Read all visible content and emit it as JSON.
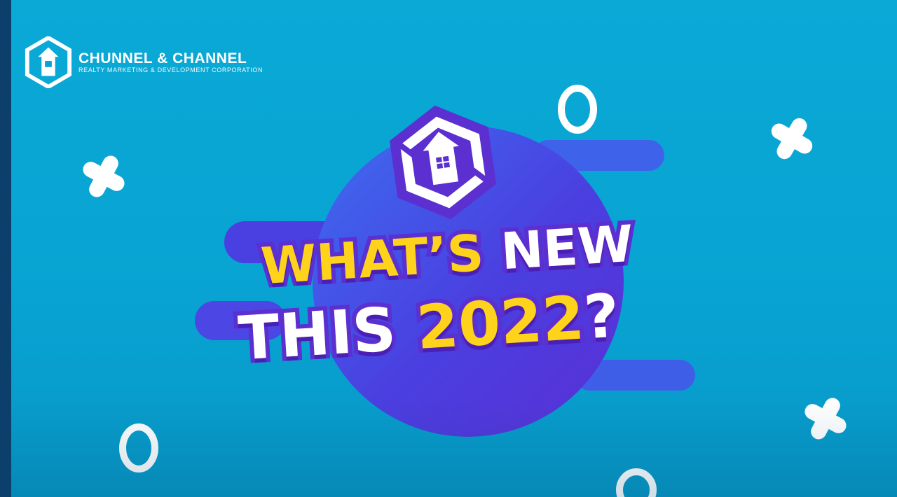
{
  "brand": {
    "name": "CHUNNEL & CHANNEL",
    "tagline": "REALTY MARKETING & DEVELOPMENT CORPORATION"
  },
  "headline": {
    "line1_part1": "WHAT’S",
    "line1_part2": "NEW",
    "line2_part1": "THIS",
    "line2_part2": "2022",
    "line2_part3": "?"
  },
  "colors": {
    "background": "#08a3d2",
    "circle": "#5b2fd0",
    "accent_yellow": "#ffd21c",
    "outline": "#5b2fd0"
  },
  "icons": [
    "logo-icon",
    "house-hexagon-icon",
    "x-shape-icon",
    "o-shape-icon"
  ]
}
